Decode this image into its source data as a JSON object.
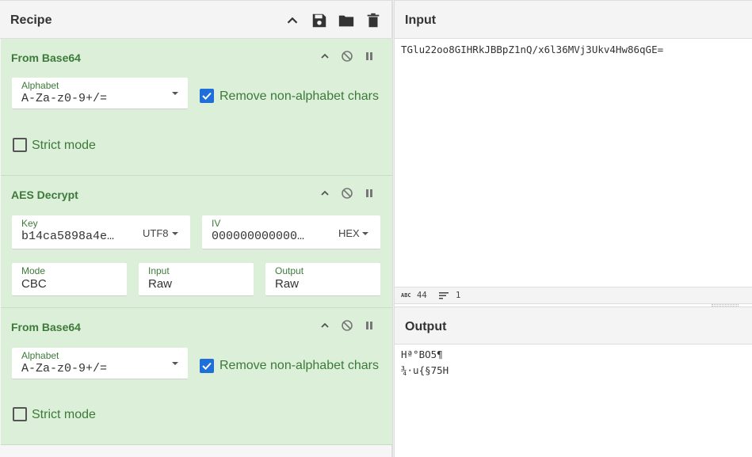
{
  "recipe": {
    "title": "Recipe",
    "operations": [
      {
        "name": "From Base64",
        "alphabet_label": "Alphabet",
        "alphabet_value": "A-Za-z0-9+/=",
        "remove_label": "Remove non-alphabet chars",
        "remove_checked": true,
        "strict_label": "Strict mode",
        "strict_checked": false
      },
      {
        "name": "AES Decrypt",
        "key_label": "Key",
        "key_value": "b14ca5898a4e…",
        "key_encoding": "UTF8",
        "iv_label": "IV",
        "iv_value": "000000000000…",
        "iv_encoding": "HEX",
        "mode_label": "Mode",
        "mode_value": "CBC",
        "input_label": "Input",
        "input_value": "Raw",
        "output_label": "Output",
        "output_value": "Raw"
      },
      {
        "name": "From Base64",
        "alphabet_label": "Alphabet",
        "alphabet_value": "A-Za-z0-9+/=",
        "remove_label": "Remove non-alphabet chars",
        "remove_checked": true,
        "strict_label": "Strict mode",
        "strict_checked": false
      }
    ]
  },
  "input": {
    "title": "Input",
    "text": "TGlu22oo8GIHRkJBBpZ1nQ/x6l36MVj3Ukv4Hw86qGE=",
    "status_length": "44",
    "status_lines": "1"
  },
  "output": {
    "title": "Output",
    "line1": "Hª°BO5¶",
    "line2": "¾·u{§75H"
  },
  "colors": {
    "op_background": "#dcefd9",
    "op_title": "#3d7a3a",
    "checkbox": "#1e6fd9"
  },
  "icons": [
    "chevron-up-icon",
    "save-icon",
    "folder-icon",
    "trash-icon",
    "disable-icon",
    "pause-icon",
    "dropdown-caret-icon",
    "check-icon",
    "abc-icon",
    "lines-icon"
  ]
}
